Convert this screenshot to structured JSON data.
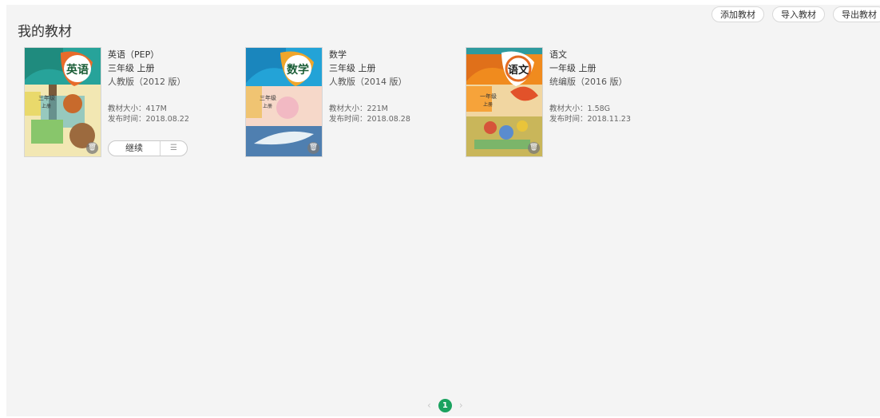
{
  "header": {
    "title": "我的教材",
    "add_label": "添加教材",
    "import_label": "导入教材",
    "export_label": "导出教材"
  },
  "books": [
    {
      "name": "英语（PEP）",
      "grade": "三年级  上册",
      "edition": "人教版（2012 版）",
      "size": "教材大小：417M",
      "release": "发布时间：2018.08.22",
      "cover_title": "英语",
      "cover_grade": "三年级",
      "cover_term": "上册",
      "continue_label": "继续"
    },
    {
      "name": "数学",
      "grade": "三年级  上册",
      "edition": "人教版（2014 版）",
      "size": "教材大小：221M",
      "release": "发布时间：2018.08.28",
      "cover_title": "数学",
      "cover_grade": "三年级",
      "cover_term": "上册"
    },
    {
      "name": "语文",
      "grade": "一年级  上册",
      "edition": "统编版（2016 版）",
      "size": "教材大小：1.58G",
      "release": "发布时间：2018.11.23",
      "cover_title": "语文",
      "cover_grade": "一年级",
      "cover_term": "上册"
    }
  ],
  "pagination": {
    "current_page": "1",
    "prev": "‹",
    "next": "›"
  },
  "colors": {
    "accent": "#1aa25f",
    "panel_bg": "#f4f4f4"
  }
}
